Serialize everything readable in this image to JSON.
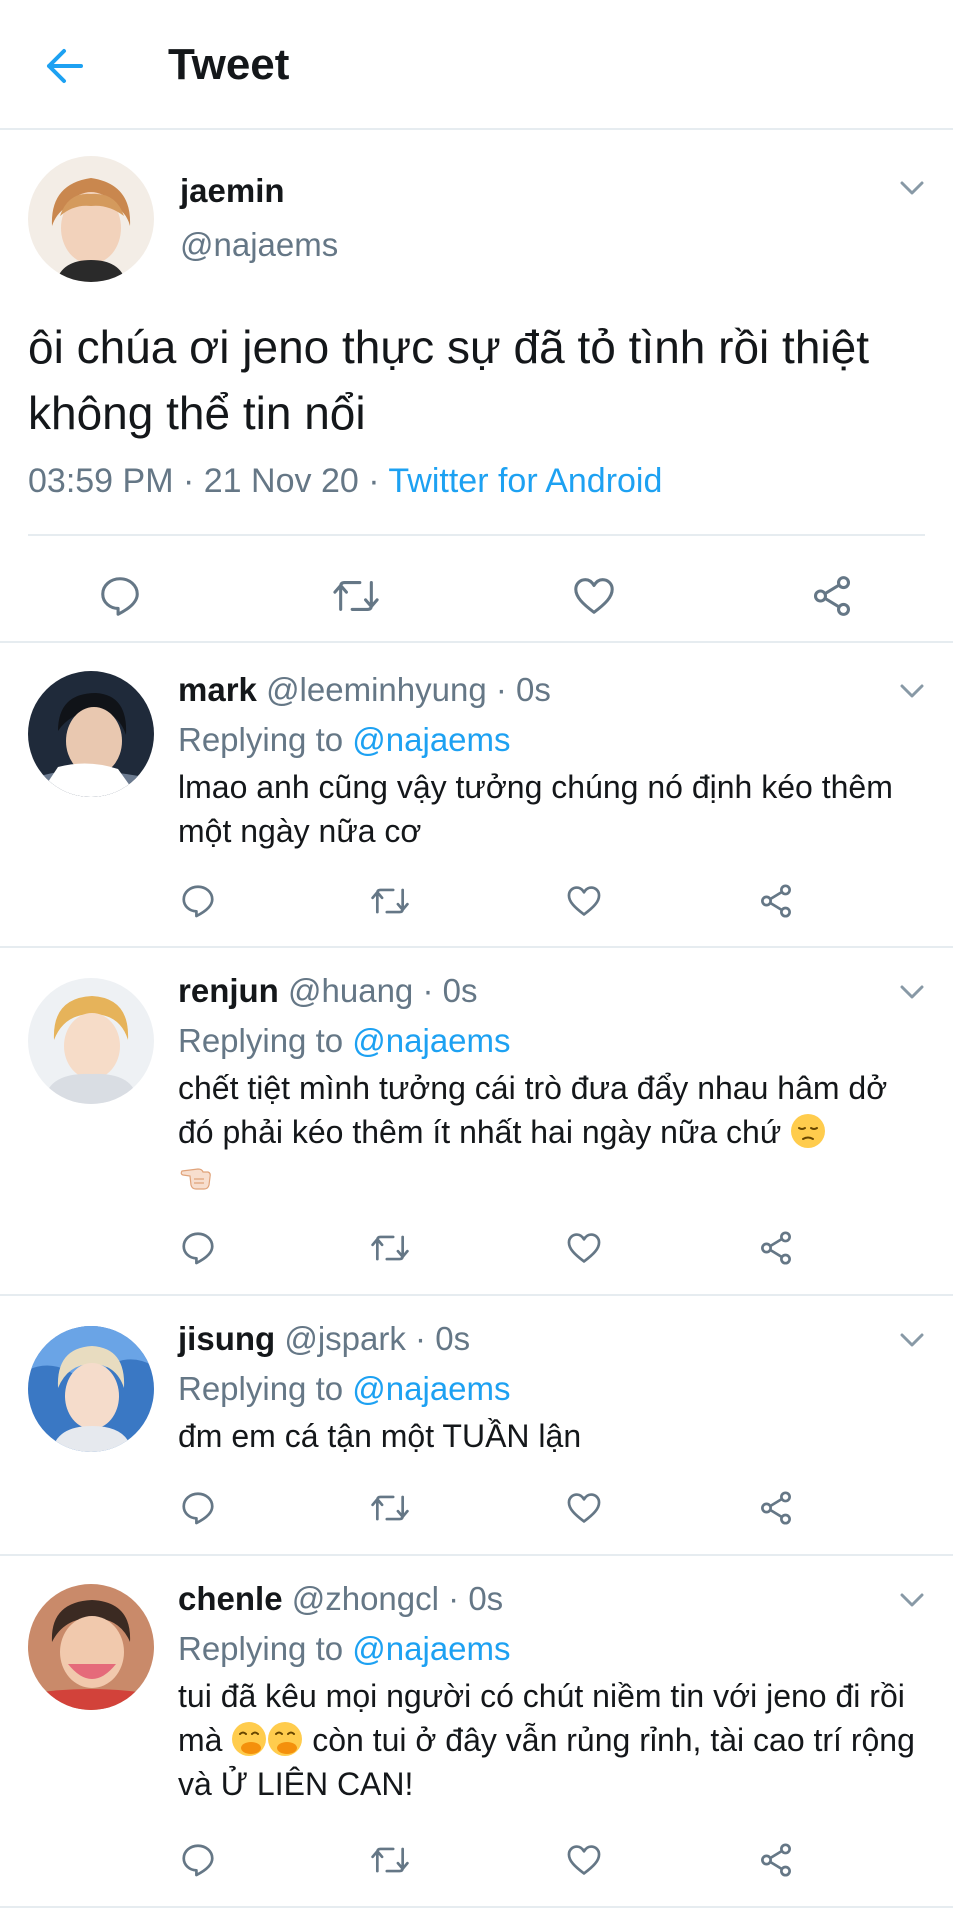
{
  "header": {
    "title": "Tweet"
  },
  "main_tweet": {
    "name": "jaemin",
    "handle": "@najaems",
    "text": "ôi chúa ơi jeno thực sự đã tỏ tình rồi thiệt không thể tin nổi",
    "time": "03:59 PM",
    "date": "21 Nov 20",
    "source": "Twitter for Android"
  },
  "replies": [
    {
      "name": "mark",
      "handle": "@leeminhyung",
      "time": "0s",
      "replying_prefix": "Replying to",
      "replying_to": "@najaems",
      "text": "lmao anh cũng vậy tưởng chúng nó định kéo thêm một ngày nữa cơ"
    },
    {
      "name": "renjun",
      "handle": "@huang",
      "time": "0s",
      "replying_prefix": "Replying to",
      "replying_to": "@najaems",
      "text": "chết tiệt mình tưởng cái trò đưa đẩy nhau hâm dở đó phải kéo thêm ít nhất hai ngày nữa chứ"
    },
    {
      "name": "jisung",
      "handle": "@jspark",
      "time": "0s",
      "replying_prefix": "Replying to",
      "replying_to": "@najaems",
      "text": "đm em cá tận một TUẦN lận"
    },
    {
      "name": "chenle",
      "handle": "@zhongcl",
      "time": "0s",
      "replying_prefix": "Replying to",
      "replying_to": "@najaems",
      "text_before_emoji": "tui đã kêu mọi người có chút niềm tin với jeno đi rồi mà",
      "text_after_emoji": "còn tui ở đây vẫn rủng rỉnh, tài cao trí rộng và Ử LIÊN CAN!"
    }
  ],
  "separator": "·",
  "colors": {
    "accent": "#1da1f2",
    "secondary_text": "#657786",
    "icon": "#657786",
    "divider": "#e6ecf0"
  },
  "icons": [
    "back-arrow-icon",
    "chevron-down-icon",
    "reply-icon",
    "retweet-icon",
    "like-icon",
    "share-icon"
  ]
}
